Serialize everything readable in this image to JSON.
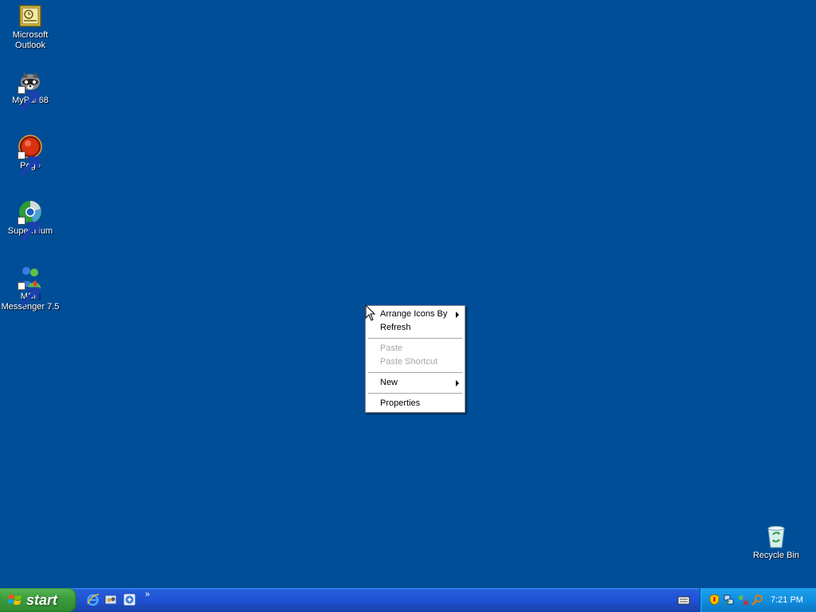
{
  "desktop": {
    "background_color": "#004e98",
    "icons": [
      {
        "label_line1": "Microsoft",
        "label_line2": "Outlook",
        "icon": "outlook-icon"
      },
      {
        "label_line1": "MyPal 68",
        "label_line2": "",
        "icon": "mypal-icon"
      },
      {
        "label_line1": "Pego",
        "label_line2": "",
        "icon": "pego-icon"
      },
      {
        "label_line1": "Supermium",
        "label_line2": "",
        "icon": "supermium-icon"
      },
      {
        "label_line1": "MSN",
        "label_line2": "Messenger 7.5",
        "icon": "msn-messenger-icon"
      }
    ],
    "recycle_bin": {
      "label": "Recycle Bin",
      "icon": "recycle-bin-icon"
    }
  },
  "context_menu": {
    "arrange_icons_by": "Arrange Icons By",
    "refresh": "Refresh",
    "paste": "Paste",
    "paste_shortcut": "Paste Shortcut",
    "new": "New",
    "properties": "Properties"
  },
  "taskbar": {
    "start_label": "start",
    "quick_launch": [
      "internet-explorer-icon",
      "show-desktop-icon",
      "mypal-quick-icon"
    ],
    "overflow_label": "»",
    "tray_icons": [
      "security-shield-icon",
      "network-icon",
      "messenger-tray-icon",
      "search-tray-icon"
    ],
    "clock": "7:21 PM"
  }
}
